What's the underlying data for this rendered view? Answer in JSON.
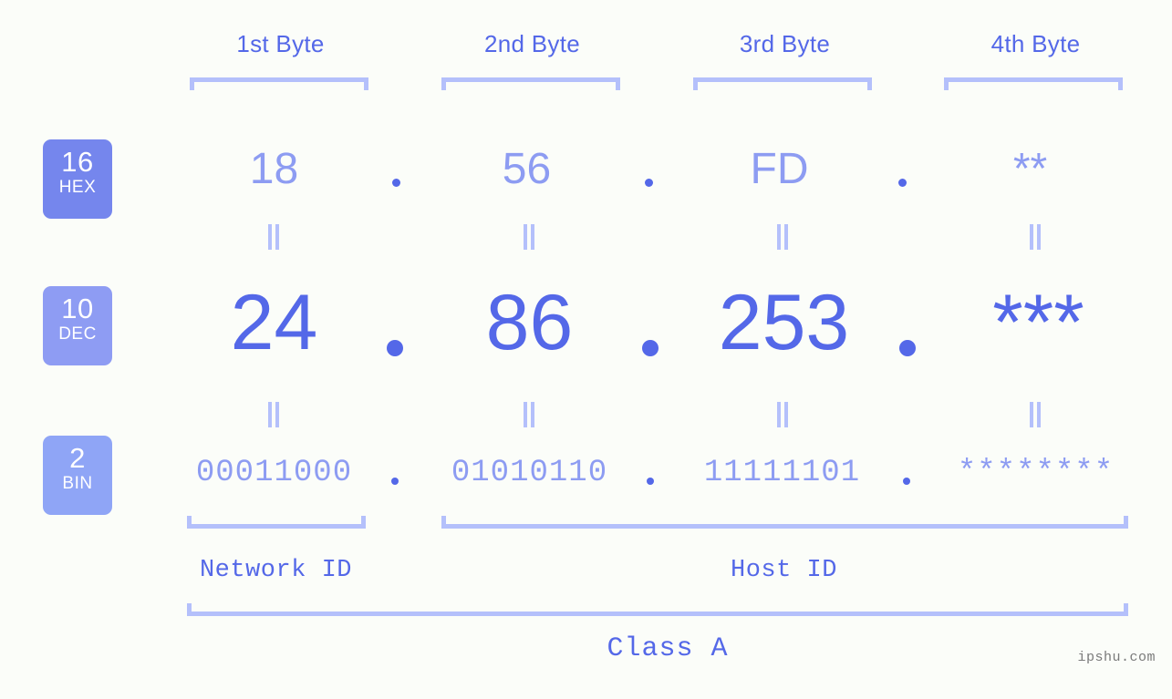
{
  "watermark": "ipshu.com",
  "byte_headers": [
    {
      "label": "1st Byte"
    },
    {
      "label": "2nd Byte"
    },
    {
      "label": "3rd Byte"
    },
    {
      "label": "4th Byte"
    }
  ],
  "bases": [
    {
      "key": "hex",
      "number": "16",
      "name": "HEX",
      "color": "#7586ed"
    },
    {
      "key": "dec",
      "number": "10",
      "name": "DEC",
      "color": "#8e9cf3"
    },
    {
      "key": "bin",
      "number": "2",
      "name": "BIN",
      "color": "#8fa5f6"
    }
  ],
  "rows": {
    "hex": {
      "b1": "18",
      "b2": "56",
      "b3": "FD",
      "b4": "**"
    },
    "dec": {
      "b1": "24",
      "b2": "86",
      "b3": "253",
      "b4": "***"
    },
    "bin": {
      "b1": "00011000",
      "b2": "01010110",
      "b3": "11111101",
      "b4": "********"
    }
  },
  "separators": {
    "hex": {
      "s1": ".",
      "s2": ".",
      "s3": "."
    },
    "dec": {
      "s1": ".",
      "s2": ".",
      "s3": "."
    },
    "bin": {
      "s1": ".",
      "s2": ".",
      "s3": "."
    }
  },
  "equals_mark": "=",
  "sections": {
    "network_id": "Network ID",
    "host_id": "Host ID",
    "class": "Class A"
  },
  "colors": {
    "background": "#fbfdf9",
    "accent_strong": "#5468e8",
    "accent_light": "#8d9cf2",
    "bracket": "#b4c0fb",
    "badge_text": "#ffffff",
    "watermark": "#7a7a7a"
  }
}
